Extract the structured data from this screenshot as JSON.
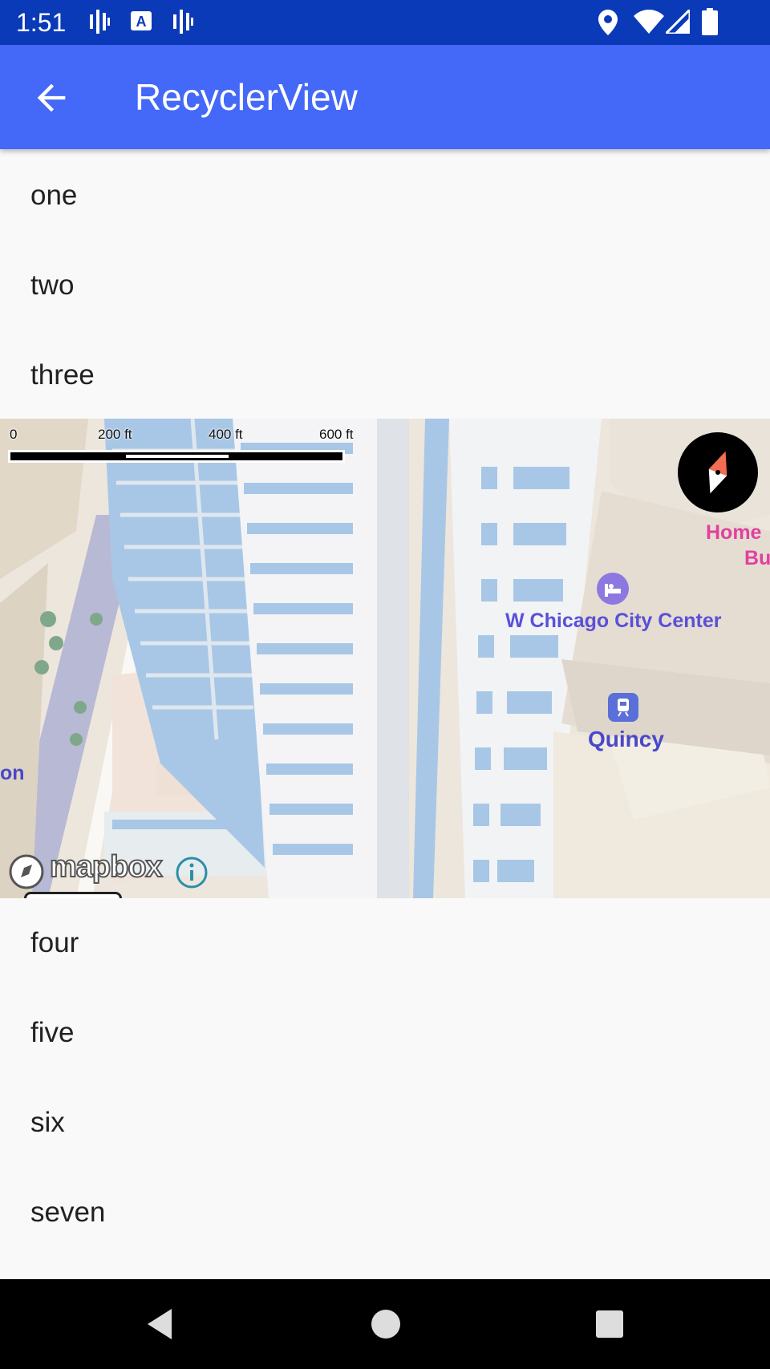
{
  "status_bar": {
    "time": "1:51",
    "icons_left": [
      "signal-bars-icon",
      "text-a-icon",
      "signal-bars-icon"
    ],
    "icons_right": [
      "location-icon",
      "wifi-icon",
      "cell-signal-icon",
      "battery-icon"
    ]
  },
  "app_bar": {
    "title": "RecyclerView",
    "back_icon": "arrow-back-icon"
  },
  "list": {
    "items_above": [
      "one",
      "two",
      "three"
    ],
    "items_below": [
      "four",
      "five",
      "six",
      "seven"
    ]
  },
  "map": {
    "scale_labels": [
      "0",
      "200 ft",
      "400 ft",
      "600 ft"
    ],
    "poi": {
      "hotel": "W Chicago City Center",
      "station": "Quincy",
      "partial_right": [
        "Home",
        "Bu"
      ],
      "partial_left": "on"
    },
    "attribution": "mapbox",
    "colors": {
      "poi_blue": "#5a50d8",
      "poi_pink": "#e0409f",
      "sky_glass": "#a8c7e6"
    }
  },
  "nav_bar": {
    "icons": [
      "nav-back-icon",
      "nav-home-icon",
      "nav-recents-icon"
    ]
  }
}
